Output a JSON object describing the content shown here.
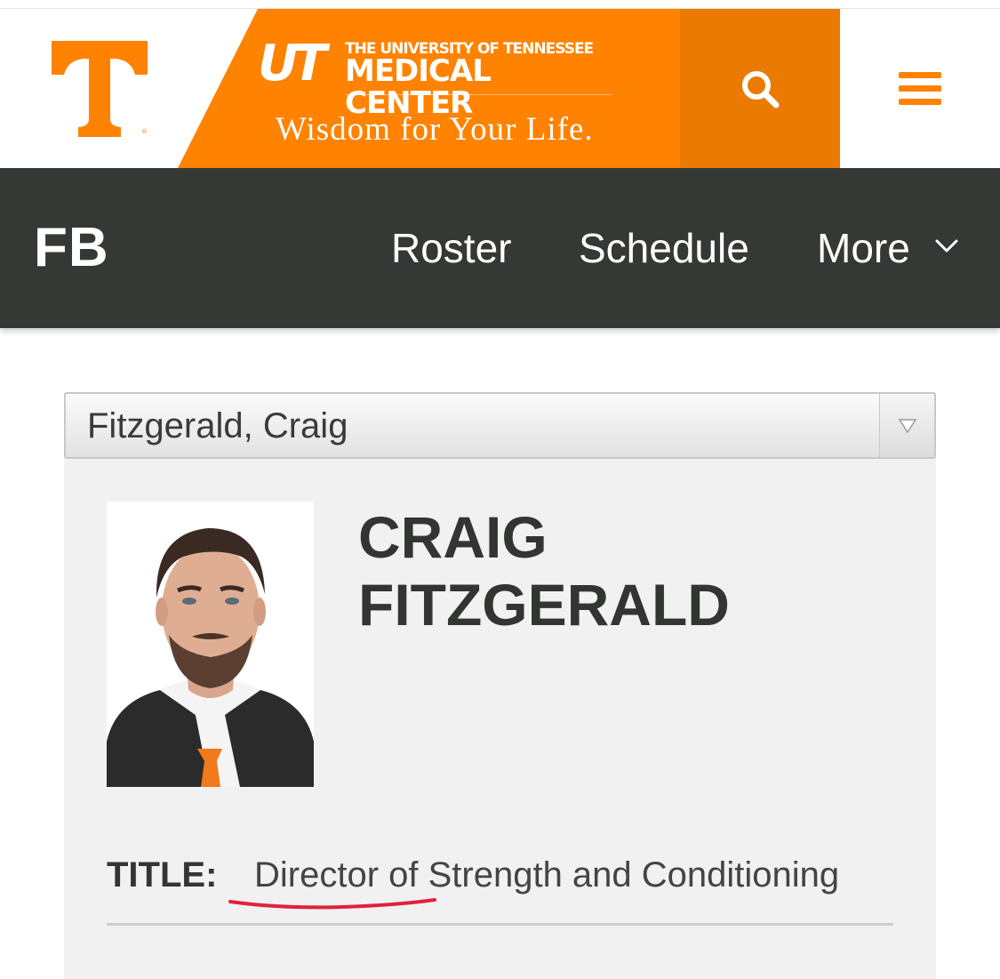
{
  "colors": {
    "brand_orange": "#ff8200",
    "search_orange": "#ea7a00",
    "nav_bg": "#353935",
    "card_bg": "#f1f1f1",
    "annotation_red": "#e0213f"
  },
  "header": {
    "logo": "T",
    "ad": {
      "mark": "UT",
      "line1": "THE UNIVERSITY OF TENNESSEE",
      "line2": "MEDICAL CENTER",
      "tagline": "Wisdom for Your Life."
    },
    "search_icon": "search-icon",
    "menu_icon": "hamburger-menu-icon"
  },
  "nav": {
    "brand": "FB",
    "links": [
      "Roster",
      "Schedule",
      "More"
    ],
    "more_icon": "chevron-down-icon"
  },
  "staff_select": {
    "selected": "Fitzgerald, Craig",
    "arrow_icon": "triangle-down-icon"
  },
  "profile": {
    "first_name": "CRAIG",
    "last_name": "FITZGERALD",
    "title_label": "TITLE:",
    "title_value": "Director of Strength and Conditioning"
  }
}
